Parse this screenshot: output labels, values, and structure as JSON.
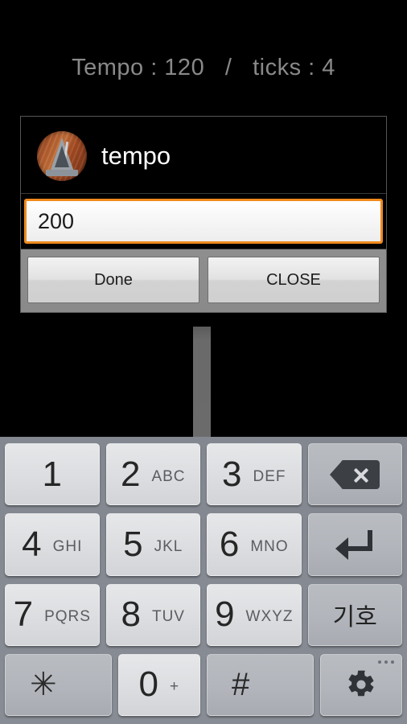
{
  "header": {
    "status_text": "Tempo : 120   /   ticks : 4",
    "tempo_label": "Tempo",
    "tempo_value": "120",
    "separator": "/",
    "ticks_label": "ticks",
    "ticks_value": "4",
    "text_color": "#898989"
  },
  "dialog": {
    "title": "tempo",
    "icon_name": "metronome-icon",
    "input": {
      "value": "200",
      "placeholder": "",
      "focus_color": "#f08a1e"
    },
    "buttons": {
      "done_label": "Done",
      "close_label": "CLOSE"
    }
  },
  "keyboard": {
    "rows": [
      [
        {
          "digit": "1",
          "letters": "",
          "type": "num",
          "name": "key-1"
        },
        {
          "digit": "2",
          "letters": "ABC",
          "type": "num",
          "name": "key-2"
        },
        {
          "digit": "3",
          "letters": "DEF",
          "type": "num",
          "name": "key-3"
        },
        {
          "digit": "",
          "letters": "",
          "type": "fn",
          "name": "key-backspace",
          "icon": "backspace-icon"
        }
      ],
      [
        {
          "digit": "4",
          "letters": "GHI",
          "type": "num",
          "name": "key-4"
        },
        {
          "digit": "5",
          "letters": "JKL",
          "type": "num",
          "name": "key-5"
        },
        {
          "digit": "6",
          "letters": "MNO",
          "type": "num",
          "name": "key-6"
        },
        {
          "digit": "",
          "letters": "",
          "type": "fn",
          "name": "key-enter",
          "icon": "return-icon"
        }
      ],
      [
        {
          "digit": "7",
          "letters": "PQRS",
          "type": "num",
          "name": "key-7"
        },
        {
          "digit": "8",
          "letters": "TUV",
          "type": "num",
          "name": "key-8"
        },
        {
          "digit": "9",
          "letters": "WXYZ",
          "type": "num",
          "name": "key-9"
        },
        {
          "digit": "기호",
          "letters": "",
          "type": "fn",
          "name": "key-symbols"
        }
      ],
      [
        {
          "digit": "✳",
          "letters": "",
          "type": "fn",
          "name": "key-asterisk"
        },
        {
          "digit": "0",
          "letters": "+",
          "type": "num",
          "name": "key-0"
        },
        {
          "digit": "#",
          "letters": "",
          "type": "fn",
          "name": "key-hash"
        },
        {
          "digit": "",
          "letters": "",
          "type": "fn",
          "name": "key-settings",
          "icon": "gear-icon"
        }
      ]
    ]
  },
  "colors": {
    "background": "#000000",
    "keyboard_bg": "#888c94",
    "key_light": "#dcdde0",
    "key_dark": "#b2b5bb",
    "accent_orange": "#f08a1e",
    "button_bar": "#8a8a8a"
  }
}
